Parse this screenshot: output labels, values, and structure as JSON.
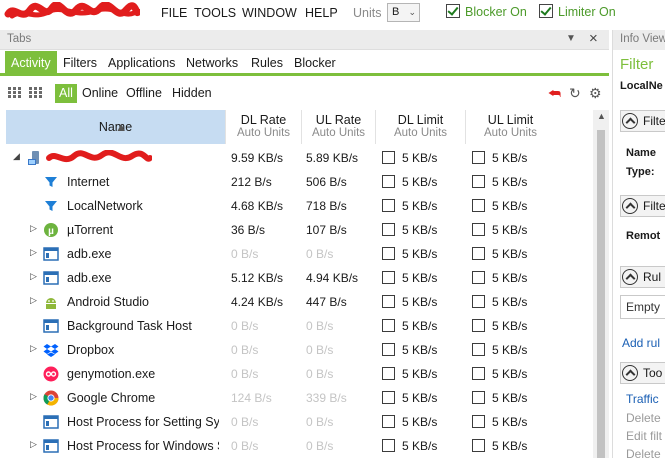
{
  "menu": {
    "file": "FILE",
    "tools": "TOOLS",
    "window": "WINDOW",
    "help": "HELP",
    "units_label": "Units",
    "units_value": "B",
    "blocker_label": "Blocker On",
    "limiter_label": "Limiter On",
    "blocker_checked": true,
    "limiter_checked": true
  },
  "tabs_pane": {
    "title": "Tabs"
  },
  "nav": [
    "Activity",
    "Filters",
    "Applications",
    "Networks",
    "Rules",
    "Blocker"
  ],
  "nav_active": "Activity",
  "filters": [
    "All",
    "Online",
    "Offline",
    "Hidden"
  ],
  "filter_active": "All",
  "table": {
    "col_name": "Name",
    "cols": [
      {
        "title": "DL Rate",
        "sub": "Auto Units"
      },
      {
        "title": "UL Rate",
        "sub": "Auto Units"
      },
      {
        "title": "DL Limit",
        "sub": "Auto Units"
      },
      {
        "title": "UL Limit",
        "sub": "Auto Units"
      }
    ],
    "rows": [
      {
        "name": "",
        "icon": "computer-icon",
        "expander": "expanded",
        "indent": 0,
        "dl": "9.59 KB/s",
        "ul": "5.89 KB/s",
        "dim": false,
        "dl_limit": "5 KB/s",
        "ul_limit": "5 KB/s"
      },
      {
        "name": "Internet",
        "icon": "filter-icon",
        "expander": "none",
        "indent": 1,
        "dl": "212 B/s",
        "ul": "506 B/s",
        "dim": false,
        "dl_limit": "5 KB/s",
        "ul_limit": "5 KB/s"
      },
      {
        "name": "LocalNetwork",
        "icon": "filter-icon",
        "expander": "none",
        "indent": 1,
        "dl": "4.68 KB/s",
        "ul": "718 B/s",
        "dim": false,
        "dl_limit": "5 KB/s",
        "ul_limit": "5 KB/s"
      },
      {
        "name": "µTorrent",
        "icon": "utorrent-icon",
        "expander": "collapsed",
        "indent": 1,
        "dl": "36 B/s",
        "ul": "107 B/s",
        "dim": false,
        "dl_limit": "5 KB/s",
        "ul_limit": "5 KB/s"
      },
      {
        "name": "adb.exe",
        "icon": "app-window-icon",
        "expander": "collapsed",
        "indent": 1,
        "dl": "0 B/s",
        "ul": "0 B/s",
        "dim": true,
        "dl_limit": "5 KB/s",
        "ul_limit": "5 KB/s"
      },
      {
        "name": "adb.exe",
        "icon": "app-window-icon",
        "expander": "collapsed",
        "indent": 1,
        "dl": "5.12 KB/s",
        "ul": "4.94 KB/s",
        "dim": false,
        "dl_limit": "5 KB/s",
        "ul_limit": "5 KB/s"
      },
      {
        "name": "Android Studio",
        "icon": "android-icon",
        "expander": "collapsed",
        "indent": 1,
        "dl": "4.24 KB/s",
        "ul": "447 B/s",
        "dim": false,
        "dl_limit": "5 KB/s",
        "ul_limit": "5 KB/s"
      },
      {
        "name": "Background Task Host",
        "icon": "app-window-icon",
        "expander": "none",
        "indent": 1,
        "dl": "0 B/s",
        "ul": "0 B/s",
        "dim": true,
        "dl_limit": "5 KB/s",
        "ul_limit": "5 KB/s"
      },
      {
        "name": "Dropbox",
        "icon": "dropbox-icon",
        "expander": "collapsed",
        "indent": 1,
        "dl": "0 B/s",
        "ul": "0 B/s",
        "dim": true,
        "dl_limit": "5 KB/s",
        "ul_limit": "5 KB/s"
      },
      {
        "name": "genymotion.exe",
        "icon": "genymotion-icon",
        "expander": "none",
        "indent": 1,
        "dl": "0 B/s",
        "ul": "0 B/s",
        "dim": true,
        "dl_limit": "5 KB/s",
        "ul_limit": "5 KB/s"
      },
      {
        "name": "Google Chrome",
        "icon": "chrome-icon",
        "expander": "collapsed",
        "indent": 1,
        "dl": "124 B/s",
        "ul": "339 B/s",
        "dim": true,
        "dl_limit": "5 KB/s",
        "ul_limit": "5 KB/s"
      },
      {
        "name": "Host Process for Setting Sync",
        "icon": "app-window-icon",
        "expander": "none",
        "indent": 1,
        "dl": "0 B/s",
        "ul": "0 B/s",
        "dim": true,
        "dl_limit": "5 KB/s",
        "ul_limit": "5 KB/s"
      },
      {
        "name": "Host Process for Windows Se",
        "icon": "app-window-icon",
        "expander": "collapsed",
        "indent": 1,
        "dl": "0 B/s",
        "ul": "0 B/s",
        "dim": true,
        "dl_limit": "5 KB/s",
        "ul_limit": "5 KB/s"
      }
    ]
  },
  "info_pane": {
    "title": "Info View",
    "filter_title": "Filter",
    "filter_subtitle": "LocalNe",
    "sections": [
      {
        "head": "Filte"
      },
      {
        "head": "Filte"
      },
      {
        "head": "Rul"
      },
      {
        "head": "Too"
      }
    ],
    "name_label": "Name",
    "type_label": "Type:",
    "remote_label": "Remot",
    "empty_text": "Empty",
    "add_rule": "Add rul",
    "traffic_link": "Traffic",
    "delete_1": "Delete",
    "edit_filter": "Edit filt",
    "delete_2": "Delete"
  },
  "colors": {
    "accent_green": "#7dbf3c",
    "header_blue": "#c6dcf2",
    "red_icon": "#e0201f",
    "link_blue": "#1a5fb4"
  }
}
